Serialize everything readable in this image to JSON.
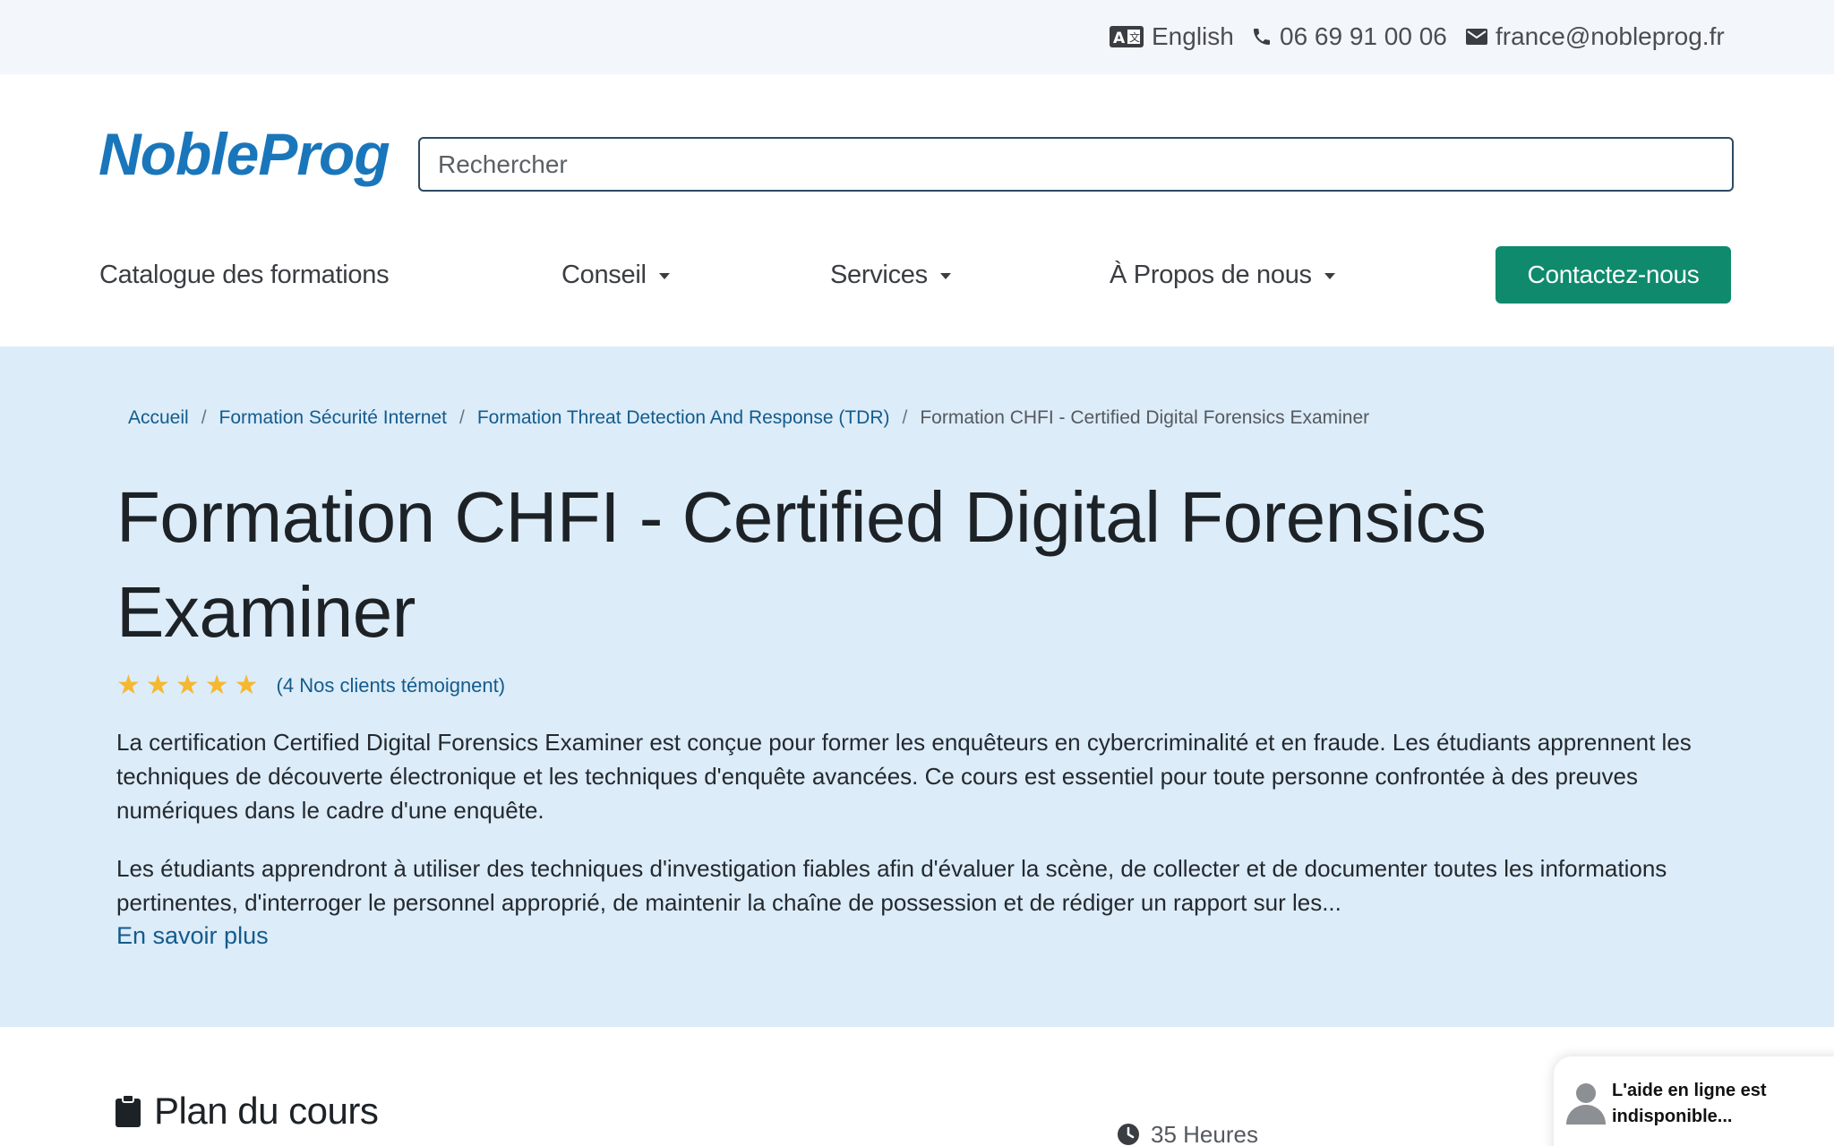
{
  "topbar": {
    "language": "English",
    "phone": "06 69 91 00 06",
    "email": "france@nobleprog.fr",
    "icons": {
      "language": "translate-icon",
      "phone": "phone-icon",
      "email": "mail-icon"
    }
  },
  "header": {
    "logo": "NobleProg",
    "search_placeholder": "Rechercher"
  },
  "nav": {
    "items": [
      {
        "label": "Catalogue des formations",
        "dropdown": false
      },
      {
        "label": "Conseil",
        "dropdown": true
      },
      {
        "label": "Services",
        "dropdown": true
      },
      {
        "label": "À Propos de nous",
        "dropdown": true
      }
    ],
    "cta": "Contactez-nous"
  },
  "breadcrumb": [
    "Accueil",
    "Formation Sécurité Internet",
    "Formation Threat Detection And Response (TDR)",
    "Formation CHFI - Certified Digital Forensics Examiner"
  ],
  "course": {
    "title": "Formation CHFI - Certified Digital Forensics Examiner",
    "rating": 5,
    "reviews_link": "(4 Nos clients témoignent)",
    "description_1": "La certification Certified Digital Forensics Examiner est conçue pour former les enquêteurs en cybercriminalité et en fraude. Les étudiants apprennent les techniques de découverte électronique et les techniques d'enquête avancées. Ce cours est essentiel pour toute personne confrontée à des preuves numériques dans le cadre d'une enquête.",
    "description_2": "Les étudiants apprendront à utiliser des techniques d'investigation fiables afin d'évaluer la scène, de collecter et de documenter toutes les informations pertinentes, d'interroger le personnel approprié, de maintenir la chaîne de possession et de rédiger un rapport sur les...",
    "read_more": "En savoir plus"
  },
  "outline": {
    "heading": "Plan du cours",
    "duration": "35 Heures"
  },
  "chat": {
    "message": "L'aide en ligne est indisponible..."
  },
  "colors": {
    "brand": "#1a76bb",
    "cta": "#0f8a6d",
    "hero_bg": "#dcecf9",
    "link": "#145b8c",
    "star": "#f5b82e"
  }
}
